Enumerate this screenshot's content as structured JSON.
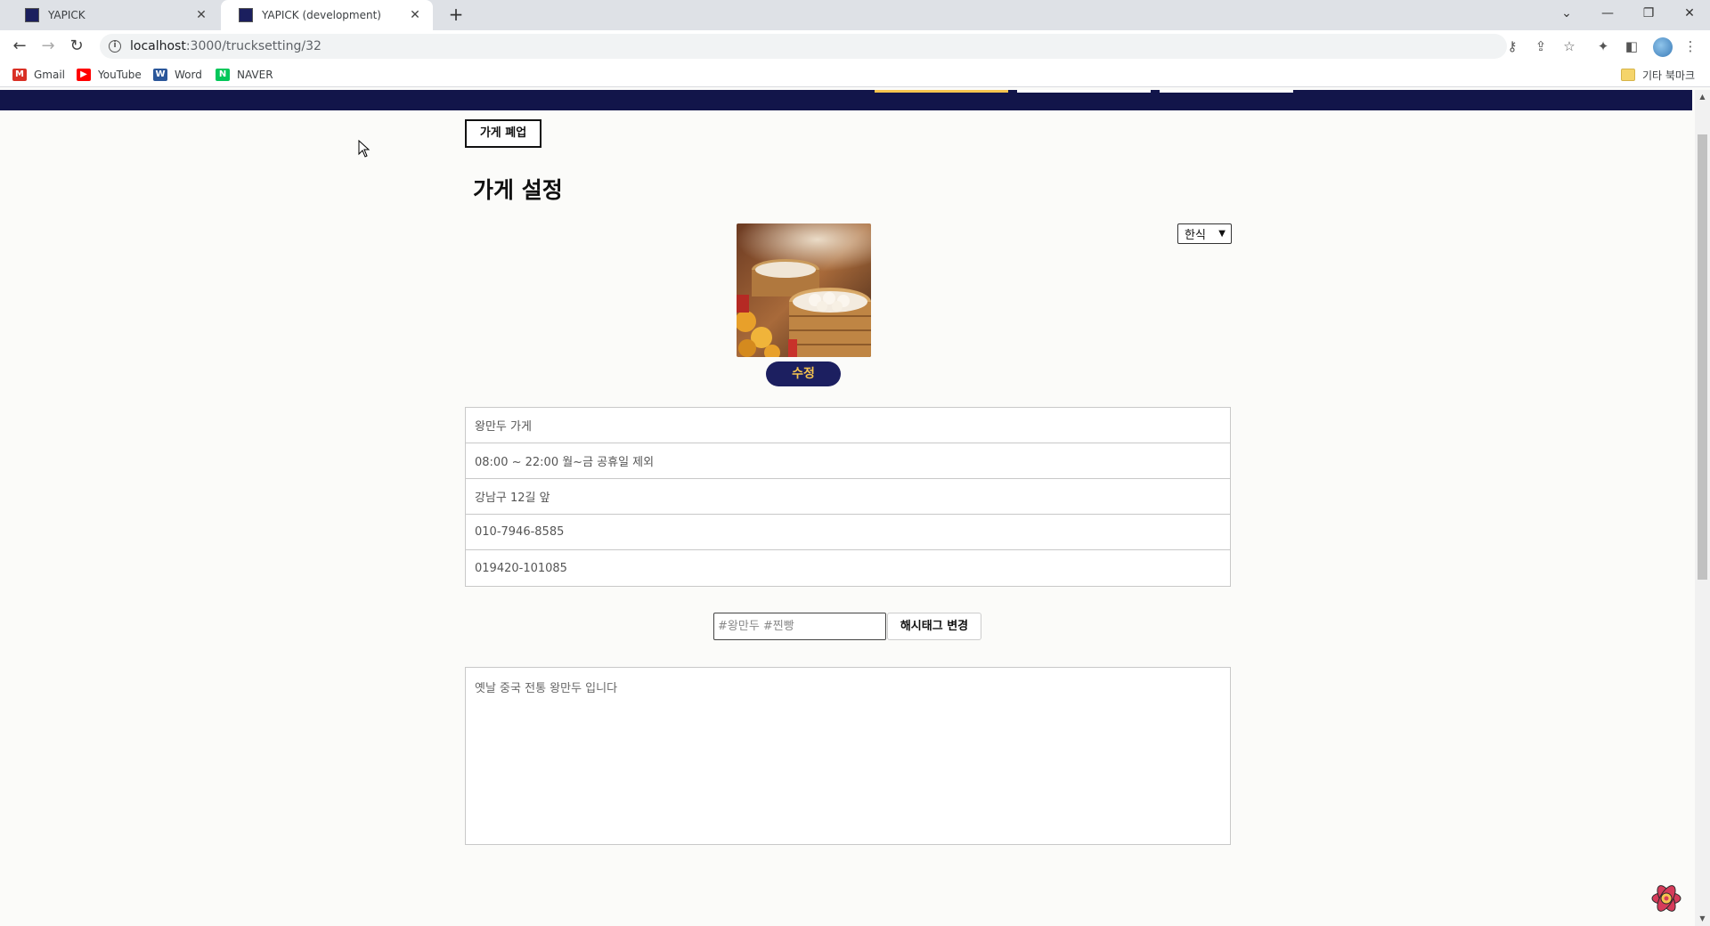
{
  "browser": {
    "tabs": [
      {
        "title": "YAPICK",
        "active": false
      },
      {
        "title": "YAPICK (development)",
        "active": true
      }
    ],
    "url_host": "localhost",
    "url_path": ":3000/trucksetting/32",
    "bookmarks": [
      {
        "label": "Gmail",
        "icon": "gmail-icon",
        "color": "#d93025"
      },
      {
        "label": "YouTube",
        "icon": "youtube-icon",
        "color": "#ff0000"
      },
      {
        "label": "Word",
        "icon": "word-icon",
        "color": "#2b579a"
      },
      {
        "label": "NAVER",
        "icon": "naver-icon",
        "color": "#03c75a"
      }
    ],
    "other_bookmarks": "기타 북마크"
  },
  "colors": {
    "header": "#12154a",
    "accent_yellow": "#f6c44f",
    "edit_button_bg": "#1c1f60"
  },
  "store": {
    "close_button": "가게 폐업",
    "title": "가게 설정",
    "image_alt_icon": "steamed-buns-image",
    "edit_button": "수정",
    "category": "한식",
    "info": {
      "name": "왕만두 가게",
      "hours": "08:00 ~ 22:00  월~금 공휴일 제외",
      "location": "강남구 12길 앞",
      "phone": "010-7946-8585",
      "business_number": "019420-101085"
    },
    "hashtag_placeholder": "#왕만두 #찐빵",
    "hashtag_button": "해시태그 변경",
    "description": "옛날 중국 전통 왕만두 입니다"
  }
}
